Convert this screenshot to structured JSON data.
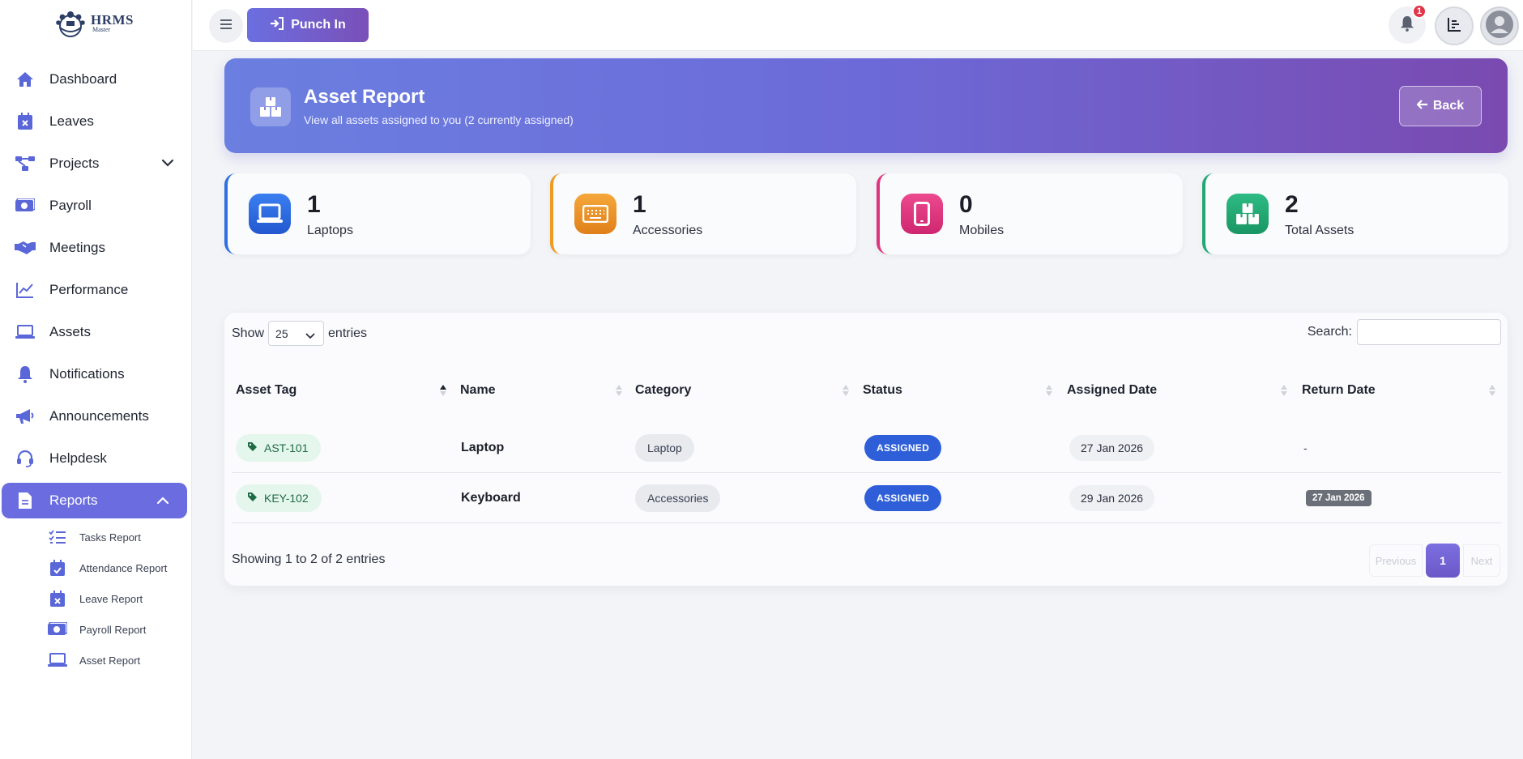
{
  "app": {
    "logo_title": "HRMS",
    "logo_sub": "Master"
  },
  "sidebar": {
    "items": [
      {
        "label": "Dashboard",
        "icon": "home-icon"
      },
      {
        "label": "Leaves",
        "icon": "calendar-x-icon"
      },
      {
        "label": "Projects",
        "icon": "project-diagram-icon"
      },
      {
        "label": "Payroll",
        "icon": "money-icon"
      },
      {
        "label": "Meetings",
        "icon": "handshake-icon"
      },
      {
        "label": "Performance",
        "icon": "line-chart-icon"
      },
      {
        "label": "Assets",
        "icon": "laptop-icon"
      },
      {
        "label": "Notifications",
        "icon": "bell-icon"
      },
      {
        "label": "Announcements",
        "icon": "megaphone-icon"
      },
      {
        "label": "Helpdesk",
        "icon": "headset-icon"
      },
      {
        "label": "Reports",
        "icon": "file-icon"
      }
    ],
    "reports_sub": [
      {
        "label": "Tasks Report",
        "icon": "task-list-icon"
      },
      {
        "label": "Attendance Report",
        "icon": "calendar-check-icon"
      },
      {
        "label": "Leave Report",
        "icon": "calendar-x-icon"
      },
      {
        "label": "Payroll Report",
        "icon": "money-icon"
      },
      {
        "label": "Asset Report",
        "icon": "laptop-icon"
      }
    ],
    "accent": "#5a67d8"
  },
  "topbar": {
    "punch_label": "Punch In",
    "notification_count": "1"
  },
  "header": {
    "title": "Asset Report",
    "subtitle": "View all assets assigned to you (2 currently assigned)",
    "back_label": "Back"
  },
  "stats": [
    {
      "value": "1",
      "label": "Laptops",
      "color": "#2f6fe0"
    },
    {
      "value": "1",
      "label": "Accessories",
      "color": "#ef9a22"
    },
    {
      "value": "0",
      "label": "Mobiles",
      "color": "#e0337e"
    },
    {
      "value": "2",
      "label": "Total Assets",
      "color": "#22a774"
    }
  ],
  "table": {
    "show_label": "Show",
    "entries_value": "25",
    "entries_label": "entries",
    "search_label": "Search:",
    "columns": [
      "Asset Tag",
      "Name",
      "Category",
      "Status",
      "Assigned Date",
      "Return Date"
    ],
    "rows": [
      {
        "tag": "AST-101",
        "name": "Laptop",
        "category": "Laptop",
        "status": "ASSIGNED",
        "assigned": "27 Jan 2026",
        "return": "-"
      },
      {
        "tag": "KEY-102",
        "name": "Keyboard",
        "category": "Accessories",
        "status": "ASSIGNED",
        "assigned": "29 Jan 2026",
        "return": "27 Jan 2026"
      }
    ],
    "info": "Showing 1 to 2 of 2 entries",
    "pager": {
      "prev": "Previous",
      "current": "1",
      "next": "Next"
    }
  }
}
